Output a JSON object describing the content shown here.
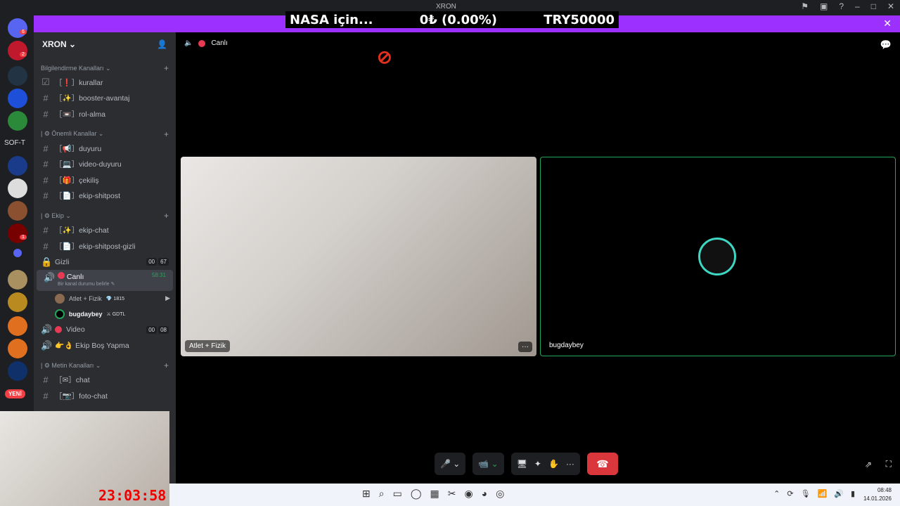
{
  "window": {
    "title": "XRON"
  },
  "ticker": {
    "left": "NASA için...",
    "mid": "0₺ (0.00%)",
    "right": "TRY50000"
  },
  "rail": {
    "soft_label": "SOF-T",
    "new_label": "YENİ",
    "badges": [
      "6",
      "2",
      "1"
    ]
  },
  "server": {
    "name": "XRON ⌄"
  },
  "categories": [
    {
      "label": "Bilgilendirme Kanalları ⌄",
      "channels": [
        "［❗］kurallar",
        "［✨］booster-avantaj",
        "［📼］rol-alma"
      ]
    },
    {
      "label": "| ⚙ Önemli Kanallar ⌄",
      "channels": [
        "［📢］duyuru",
        "［💻］video-duyuru",
        "［🎁］çekiliş",
        "［📄］ekip-shitpost"
      ]
    },
    {
      "label": "| ⚙ Ekip ⌄",
      "channels": [
        "［✨］ekip-chat",
        "［📄］ekip-shitpost-gizli"
      ]
    }
  ],
  "voice": {
    "gizli": {
      "label": "Gizli",
      "c1": "00",
      "c2": "67"
    },
    "canli": {
      "label": "Canlı",
      "status": "Bir kanal durumu belirle ✎",
      "timer": "58:31"
    },
    "users": [
      {
        "name": "Atlet + Fizik",
        "tag": "💎 1815"
      },
      {
        "name": "bugdaybey",
        "tag": "⚔ GDTL"
      }
    ],
    "video": {
      "label": "Video",
      "c1": "00",
      "c2": "08"
    },
    "bos": {
      "label": "👉👌 Ekip Boş Yapma"
    }
  },
  "metin": {
    "label": "| ⚙ Metin Kanalları ⌄",
    "channels": [
      "［✉］chat",
      "［📷］foto-chat"
    ]
  },
  "stage": {
    "header": "Canlı",
    "tile_left": {
      "name": "Atlet + Fizik",
      "more": "···"
    },
    "tile_right": {
      "name": "bugdaybey"
    }
  },
  "controls": {
    "mic": "🎤 ⌄",
    "cam": "📹 ⌄",
    "share": "🖥",
    "activities": "✦",
    "soundboard": "✋",
    "more": "···",
    "hangup": "☎"
  },
  "cam": {
    "clock": "23:03:58"
  },
  "taskbar": {
    "time": "08:48",
    "date": "14.01.2026"
  }
}
